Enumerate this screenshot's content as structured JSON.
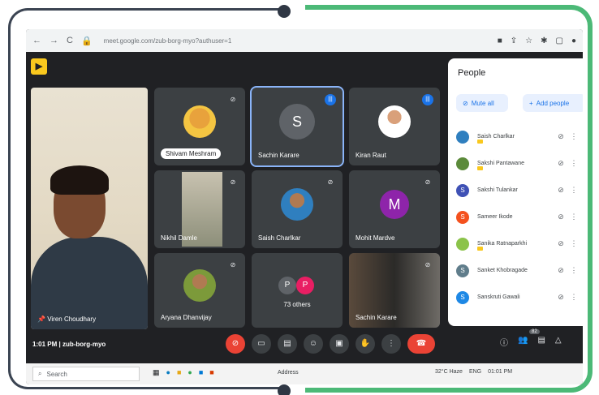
{
  "browser": {
    "url": "meet.google.com/zub-borg-myo?authuser=1",
    "nav": {
      "back": "←",
      "forward": "→",
      "reload": "C"
    }
  },
  "self": {
    "name": "Viren Choudhary"
  },
  "tiles": [
    {
      "name": "Shivam Meshram",
      "initial": "",
      "avatar_color": "#e8a23c"
    },
    {
      "name": "Sachin Karare",
      "initial": "S",
      "avatar_color": "#5f6368"
    },
    {
      "name": "Kiran Raut",
      "initial": "",
      "avatar_color": "#9e9e9e"
    },
    {
      "name": "Nikhil Damle",
      "initial": "",
      "avatar_color": "#8d8f7a"
    },
    {
      "name": "Saish Charlkar",
      "initial": "",
      "avatar_color": "#2f7fbf"
    },
    {
      "name": "Mohit Mardve",
      "initial": "M",
      "avatar_color": "#8e24aa"
    },
    {
      "name": "Aryana Dhanvijay",
      "initial": "",
      "avatar_color": "#7c9a3a"
    },
    {
      "name": "73 others",
      "initial": "P",
      "avatar_color": "#5f6368"
    },
    {
      "name": "Sachin Karare",
      "initial": "",
      "avatar_color": "#444444"
    }
  ],
  "people_panel": {
    "title": "People",
    "mute_all": "Mute all",
    "add_people": "Add people",
    "members": [
      {
        "name": "Saish Charlkar",
        "initial": "",
        "color": "#2f7fbf"
      },
      {
        "name": "Sakshi Pantawane",
        "initial": "",
        "color": "#5b8a3a"
      },
      {
        "name": "Sakshi Tulankar",
        "initial": "S",
        "color": "#3f51b5"
      },
      {
        "name": "Sameer Ikode",
        "initial": "S",
        "color": "#f4511e"
      },
      {
        "name": "Sanika Ratnaparkhi",
        "initial": "",
        "color": "#8bc34a"
      },
      {
        "name": "Sanket Khobragade",
        "initial": "S",
        "color": "#607d8b"
      },
      {
        "name": "Sanskruti Gawali",
        "initial": "S",
        "color": "#1e88e5"
      }
    ]
  },
  "meeting": {
    "time": "1:01 PM",
    "separator": "|",
    "code": "zub-borg-myo"
  },
  "controls": {
    "participants_badge": "82"
  },
  "taskbar": {
    "search": "Search",
    "address": "Address",
    "weather": "32°C Haze",
    "lang": "ENG",
    "time": "01:01 PM"
  }
}
